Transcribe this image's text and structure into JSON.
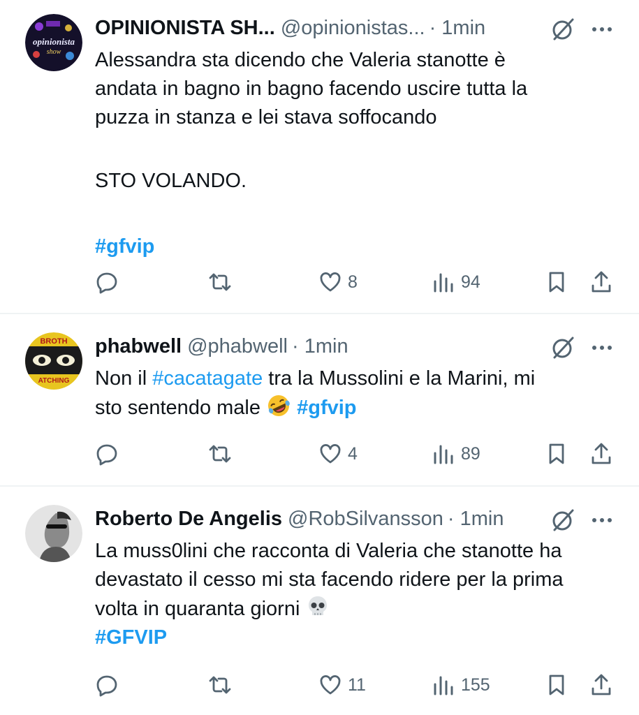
{
  "tweets": [
    {
      "name": "OPINIONISTA SH...",
      "handle": "@opinionistas...",
      "time": "· 1min",
      "lines": [
        "Alessandra sta dicendo che Valeria  stanotte è",
        "andata in bagno  in bagno facendo uscire tutta la",
        "puzza in stanza e lei stava soffocando",
        "",
        "STO VOLANDO.",
        "",
        "#gfvip"
      ],
      "avatar_text": "opinionista show",
      "likes": "8",
      "views": "94"
    },
    {
      "name": "phabwell",
      "handle": "@phabwell",
      "time": "· 1min",
      "line1_pre": "Non il ",
      "line1_tag": "#cacatagate",
      "line1_post": " tra la Mussolini e la Marini, mi",
      "line2_pre": "sto sentendo male ",
      "line2_tag": "#gfvip",
      "avatar_top": "BROTH",
      "avatar_bottom": "ATCHING",
      "likes": "4",
      "views": "89"
    },
    {
      "name": "Roberto De Angelis",
      "handle": "@RobSilvansson",
      "time": "· 1min",
      "lines": [
        "La muss0lini che racconta di Valeria che stanotte ha",
        "devastato il cesso mi sta facendo ridere per la prima",
        "volta in quaranta giorni "
      ],
      "tag": "#GFVIP",
      "likes": "11",
      "views": "155"
    }
  ],
  "icons": {
    "reply": "reply-icon",
    "retweet": "retweet-icon",
    "like": "heart-icon",
    "views": "views-icon",
    "bookmark": "bookmark-icon",
    "share": "share-icon",
    "grok": "grok-icon",
    "more": "more-icon"
  },
  "colors": {
    "hashtag": "#1d9bf0",
    "secondary": "#536471",
    "divider": "#eff3f4"
  }
}
